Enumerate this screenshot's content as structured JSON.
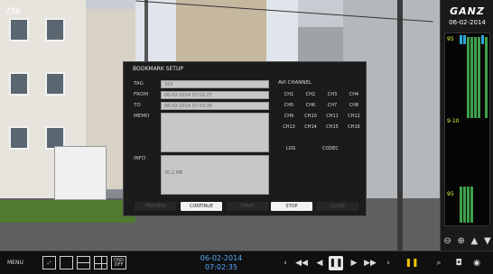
{
  "camera": {
    "overlay_label": "Z3B"
  },
  "right_panel": {
    "logo": "GANZ",
    "date": "06-02-2014",
    "meter_labels": [
      "95",
      "9-10",
      "95"
    ],
    "zoom_out_icon": "zoom-out-icon",
    "zoom_in_icon": "zoom-in-icon",
    "up_icon": "arrow-up-icon",
    "down_icon": "arrow-down-icon"
  },
  "dialog": {
    "title": "BOOKMARK SETUP",
    "tag_label": "TAG",
    "tag_value": "333",
    "from_label": "FROM",
    "from_value": "06-02-2014 07:02:27",
    "to_label": "TO",
    "to_value": "06-02-2014 07:03:36",
    "memo_label": "MEMO",
    "memo_value": "",
    "info_label": "INFO",
    "info_value": "30.2 MB",
    "avi_channel_title": "AVI CHANNEL",
    "channels": [
      "CH1",
      "CH2",
      "CH3",
      "CH4",
      "CH5",
      "CH6",
      "CH7",
      "CH8",
      "CH9",
      "CH10",
      "CH11",
      "CH12",
      "CH13",
      "CH14",
      "CH15",
      "CH16"
    ],
    "log_label": "LOG",
    "codec_label": "CODEC",
    "buttons": {
      "preview": "PREVIEW",
      "continue": "CONTINUE",
      "start": "START",
      "stop": "STOP",
      "close": "CLOSE"
    }
  },
  "toolbar": {
    "menu_label": "MENU",
    "layouts": [
      "fullscreen",
      "1x1",
      "2x1",
      "2x2",
      "osd-off"
    ],
    "osd_label": "OSD OFF",
    "date": "06-02-2014",
    "time": "07:02:35",
    "controls": [
      "prev-icon",
      "fast-rewind-icon",
      "rewind-icon",
      "pause-icon",
      "play-icon",
      "fast-forward-icon",
      "next-icon",
      "pause-icon",
      "zoom-icon",
      "camera-icon",
      "record-icon"
    ]
  },
  "colors": {
    "accent_blue": "#5aa7ff",
    "meter_green": "#3fa14a",
    "meter_blue": "#27a9d9",
    "pause_yellow": "#f3c900",
    "dialog_bg": "#1b1b1b"
  }
}
